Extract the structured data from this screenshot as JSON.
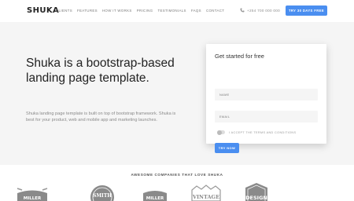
{
  "navbar": {
    "brand": "SHUKA",
    "links": [
      "CLIENTS",
      "FEATURES",
      "HOW IT WORKS",
      "PRICING",
      "TESTIMONIALS",
      "FAQS",
      "CONTACT"
    ],
    "phone": "+254 700 000 000",
    "cta": "TRY 30 DAYS FREE"
  },
  "hero": {
    "title": "Shuka is a bootstrap-based landing page template.",
    "description": "Shuka landing page template is built on top of bootstrap framework. Shuka is best for your product, web and mobile app and marketing launches."
  },
  "form": {
    "title": "Get started for free",
    "name_placeholder": "NAME",
    "email_placeholder": "EMAIL",
    "terms_label": "I ACCEPT THE TERMS AND CONDITIONS",
    "submit": "TRY NOW"
  },
  "companies": {
    "title": "AWESOME COMPANIES THAT LOVE SHUKA",
    "logos": [
      "MILLER",
      "SMITH",
      "MILLER",
      "VINTAGE",
      "DESIGN"
    ]
  },
  "colors": {
    "accent": "#4a8ef0",
    "hero_bg": "#f5f5f5"
  }
}
